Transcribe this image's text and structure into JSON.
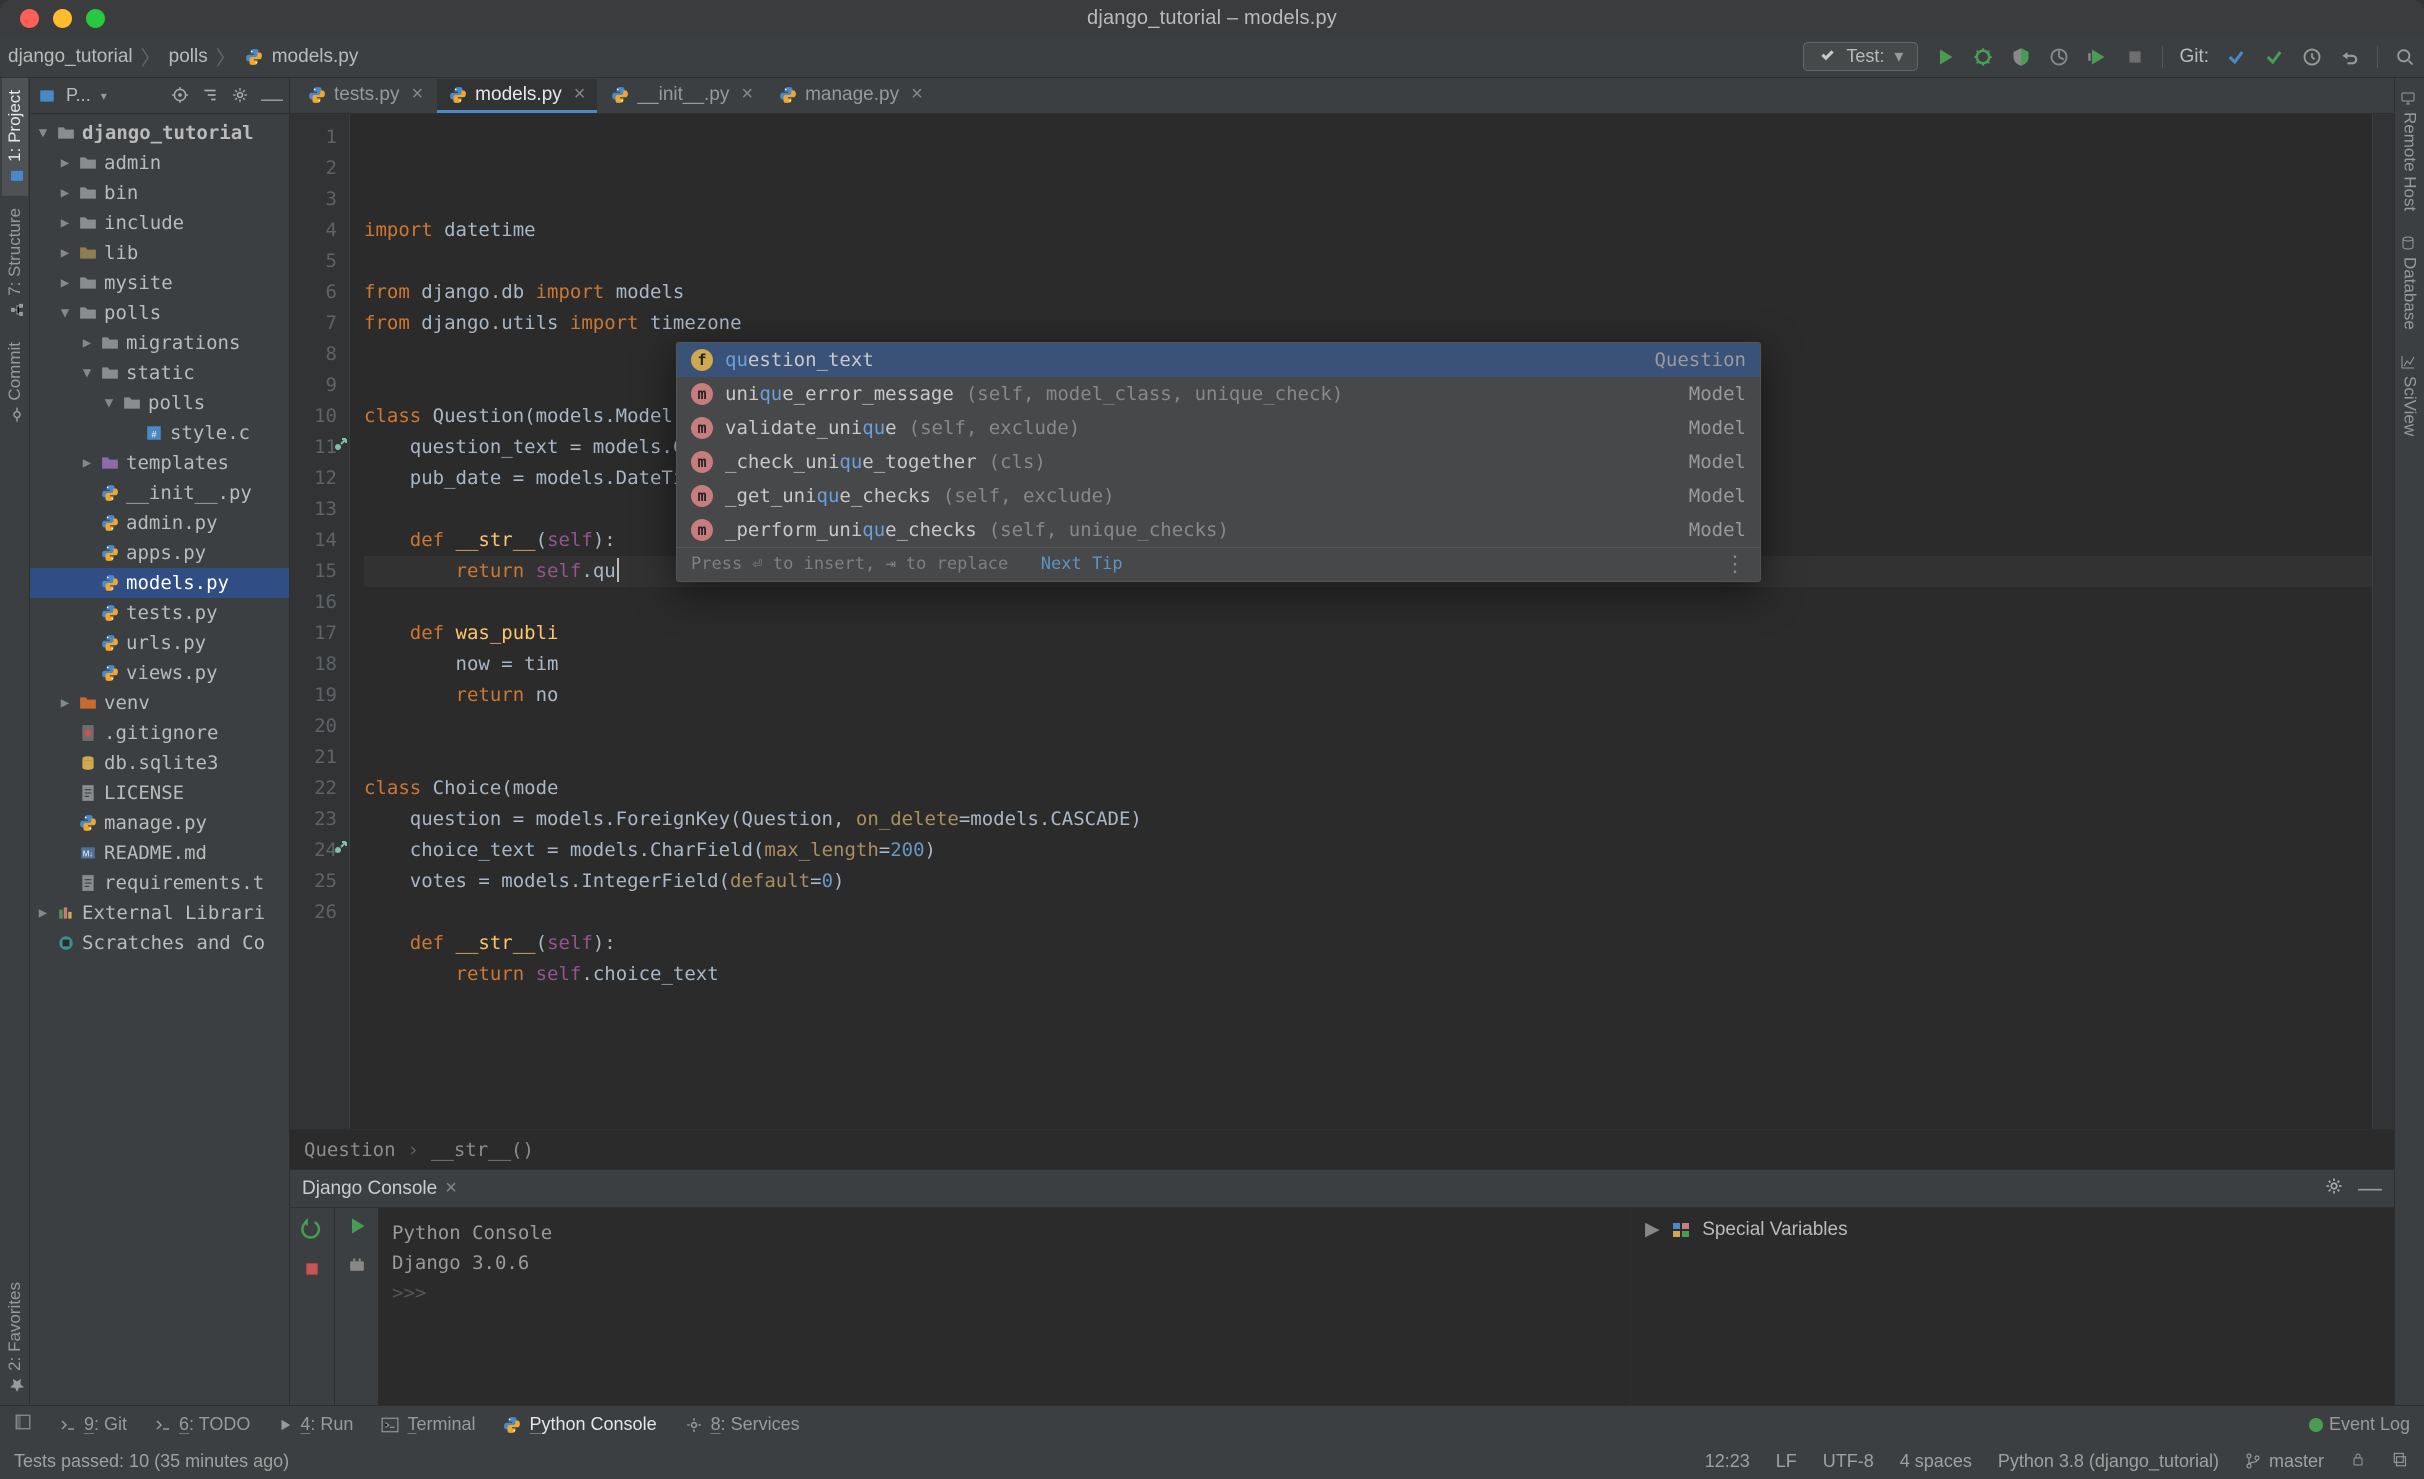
{
  "window_title": "django_tutorial – models.py",
  "breadcrumbs": [
    "django_tutorial",
    "polls",
    "models.py"
  ],
  "run_config": {
    "label": "Test:"
  },
  "git_label": "Git:",
  "sidebar_header": {
    "title": "P..."
  },
  "left_tabs": [
    "1: Project",
    "7: Structure",
    "Commit",
    "2: Favorites"
  ],
  "right_tabs": [
    "Remote Host",
    "Database",
    "SciView"
  ],
  "tree": [
    {
      "depth": 0,
      "caret": "open",
      "icon": "folder-open",
      "label": "django_tutorial",
      "bold": true
    },
    {
      "depth": 1,
      "caret": "closed",
      "icon": "folder",
      "label": "admin"
    },
    {
      "depth": 1,
      "caret": "closed",
      "icon": "folder",
      "label": "bin"
    },
    {
      "depth": 1,
      "caret": "closed",
      "icon": "folder",
      "label": "include"
    },
    {
      "depth": 1,
      "caret": "closed",
      "icon": "folder-lib",
      "label": "lib"
    },
    {
      "depth": 1,
      "caret": "closed",
      "icon": "folder",
      "label": "mysite"
    },
    {
      "depth": 1,
      "caret": "open",
      "icon": "folder",
      "label": "polls"
    },
    {
      "depth": 2,
      "caret": "closed",
      "icon": "folder",
      "label": "migrations"
    },
    {
      "depth": 2,
      "caret": "open",
      "icon": "folder",
      "label": "static"
    },
    {
      "depth": 3,
      "caret": "open",
      "icon": "folder",
      "label": "polls"
    },
    {
      "depth": 4,
      "caret": "none",
      "icon": "css",
      "label": "style.c"
    },
    {
      "depth": 2,
      "caret": "closed",
      "icon": "folder-templates",
      "label": "templates"
    },
    {
      "depth": 2,
      "caret": "none",
      "icon": "py",
      "label": "__init__.py"
    },
    {
      "depth": 2,
      "caret": "none",
      "icon": "py",
      "label": "admin.py"
    },
    {
      "depth": 2,
      "caret": "none",
      "icon": "py",
      "label": "apps.py"
    },
    {
      "depth": 2,
      "caret": "none",
      "icon": "py",
      "label": "models.py",
      "sel": true
    },
    {
      "depth": 2,
      "caret": "none",
      "icon": "py",
      "label": "tests.py"
    },
    {
      "depth": 2,
      "caret": "none",
      "icon": "py",
      "label": "urls.py"
    },
    {
      "depth": 2,
      "caret": "none",
      "icon": "py",
      "label": "views.py"
    },
    {
      "depth": 1,
      "caret": "closed",
      "icon": "folder-venv",
      "label": "venv"
    },
    {
      "depth": 1,
      "caret": "none",
      "icon": "gitignore",
      "label": ".gitignore"
    },
    {
      "depth": 1,
      "caret": "none",
      "icon": "db",
      "label": "db.sqlite3"
    },
    {
      "depth": 1,
      "caret": "none",
      "icon": "txt",
      "label": "LICENSE"
    },
    {
      "depth": 1,
      "caret": "none",
      "icon": "py",
      "label": "manage.py"
    },
    {
      "depth": 1,
      "caret": "none",
      "icon": "md",
      "label": "README.md"
    },
    {
      "depth": 1,
      "caret": "none",
      "icon": "txt",
      "label": "requirements.t"
    },
    {
      "depth": 0,
      "caret": "closed",
      "icon": "ext",
      "label": "External Librari"
    },
    {
      "depth": 0,
      "caret": "none",
      "icon": "scratch",
      "label": "Scratches and Co"
    }
  ],
  "tabs": [
    {
      "label": "tests.py",
      "active": false
    },
    {
      "label": "models.py",
      "active": true
    },
    {
      "label": "__init__.py",
      "active": false
    },
    {
      "label": "manage.py",
      "active": false
    }
  ],
  "gutter_lines": [
    "1",
    "2",
    "3",
    "4",
    "5",
    "6",
    "7",
    "8",
    "9",
    "10",
    "11",
    "12",
    "13",
    "14",
    "15",
    "16",
    "17",
    "18",
    "19",
    "20",
    "21",
    "22",
    "23",
    "24",
    "25",
    "26"
  ],
  "override_markers": [
    11,
    24
  ],
  "code_lines": [
    {
      "html": "<span class='kw'>import</span> datetime"
    },
    {
      "html": ""
    },
    {
      "html": "<span class='kw'>from</span> django.db <span class='kw'>import</span> models"
    },
    {
      "html": "<span class='kw'>from</span> django.utils <span class='kw'>import</span> timezone"
    },
    {
      "html": ""
    },
    {
      "html": ""
    },
    {
      "html": "<span class='kw'>class</span> Question(models.Model):"
    },
    {
      "html": "    question_text = models.CharField(<span class='param'>max_length</span>=<span class='num'>200</span>)"
    },
    {
      "html": "    pub_date = models.DateTimeField(<span class='str'>'date published'</span>)"
    },
    {
      "html": ""
    },
    {
      "html": "    <span class='kw'>def</span> <span class='fn'>__str__</span>(<span class='st'>self</span>):"
    },
    {
      "html": "        <span class='kw'>return</span> <span class='st'>self</span>.qu<span class='caret-blink'></span>",
      "current": true
    },
    {
      "html": ""
    },
    {
      "html": "    <span class='kw'>def</span> <span class='fn'>was_publi</span>"
    },
    {
      "html": "        now = tim"
    },
    {
      "html": "        <span class='kw'>return</span> no"
    },
    {
      "html": ""
    },
    {
      "html": ""
    },
    {
      "html": "<span class='kw'>class</span> Choice(mode"
    },
    {
      "html": "    question = models.ForeignKey(Question, <span class='param'>on_delete</span>=models.CASCADE)"
    },
    {
      "html": "    choice_text = models.CharField(<span class='param'>max_length</span>=<span class='num'>200</span>)"
    },
    {
      "html": "    votes = models.IntegerField(<span class='param'>default</span>=<span class='num'>0</span>)"
    },
    {
      "html": ""
    },
    {
      "html": "    <span class='kw'>def</span> <span class='fn'>__str__</span>(<span class='st'>self</span>):"
    },
    {
      "html": "        <span class='kw'>return</span> <span class='st'>self</span>.choice_text"
    },
    {
      "html": ""
    }
  ],
  "autocomplete": {
    "items": [
      {
        "icon": "field",
        "name_html": "<em>qu</em>estion_text",
        "params": "",
        "cls": "Question",
        "sel": true
      },
      {
        "icon": "method",
        "name_html": "uni<em>qu</em>e_error_message",
        "params": "(self, model_class, unique_check)",
        "cls": "Model"
      },
      {
        "icon": "method",
        "name_html": "validate_uni<em>qu</em>e",
        "params": "(self, exclude)",
        "cls": "Model"
      },
      {
        "icon": "method",
        "name_html": "_check_uni<em>qu</em>e_together",
        "params": "(cls)",
        "cls": "Model"
      },
      {
        "icon": "method",
        "name_html": "_get_uni<em>qu</em>e_checks",
        "params": "(self, exclude)",
        "cls": "Model"
      },
      {
        "icon": "method",
        "name_html": "_perform_uni<em>qu</em>e_checks",
        "params": "(self, unique_checks)",
        "cls": "Model"
      }
    ],
    "footer_hint": "Press ⏎ to insert, ⇥ to replace",
    "footer_link": "Next Tip"
  },
  "code_breadcrumb": [
    "Question",
    "__str__()"
  ],
  "console": {
    "tab_title": "Django Console",
    "lines": [
      "Python Console",
      "Django 3.0.6",
      "",
      ">>>"
    ],
    "vars_label": "Special Variables"
  },
  "toolstrip": {
    "items": [
      {
        "label": "9: Git",
        "u": "9"
      },
      {
        "label": "6: TODO",
        "u": "6"
      },
      {
        "label": "4: Run",
        "u": "4",
        "play": true
      },
      {
        "label": "Terminal",
        "u": "T",
        "term": true
      },
      {
        "label": "Python Console",
        "u": "P",
        "active": true,
        "py": true
      },
      {
        "label": "8: Services",
        "u": "8",
        "gear": true
      }
    ],
    "event_log": "Event Log"
  },
  "status": {
    "message": "Tests passed: 10 (35 minutes ago)",
    "clock": "12:23",
    "line_ending": "LF",
    "encoding": "UTF-8",
    "indent": "4 spaces",
    "interpreter": "Python 3.8 (django_tutorial)",
    "branch": "master"
  }
}
